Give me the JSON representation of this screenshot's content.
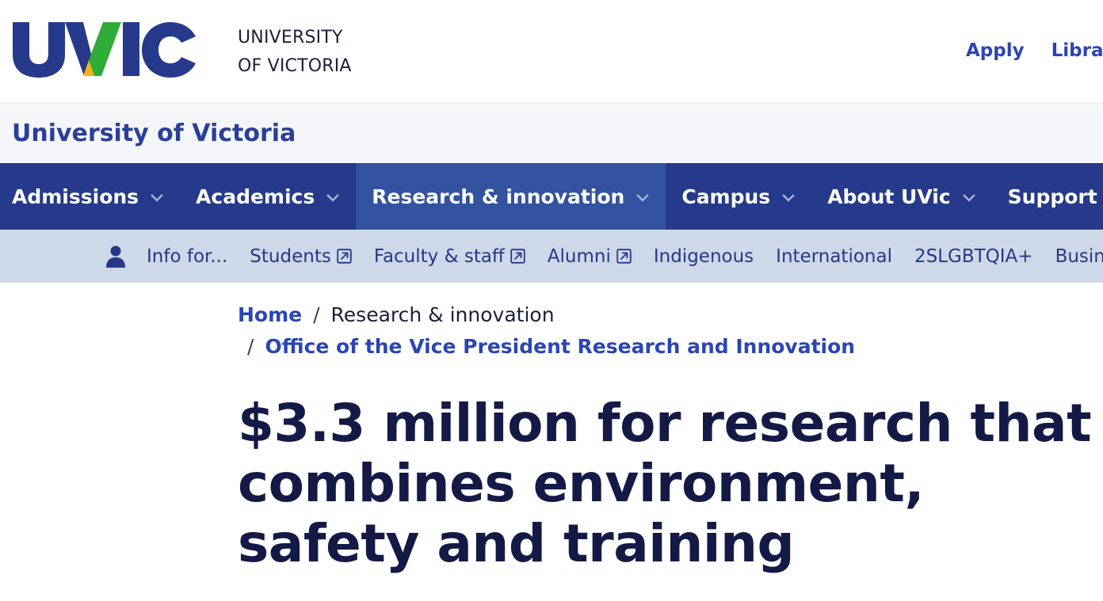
{
  "header": {
    "logo_alt": "UVIC",
    "wordmark_line1": "UNIVERSITY",
    "wordmark_line2": "OF VICTORIA",
    "utility_links": [
      "Apply",
      "Library"
    ]
  },
  "site_title": "University of Victoria",
  "main_nav": [
    {
      "label": "Admissions",
      "active": false
    },
    {
      "label": "Academics",
      "active": false
    },
    {
      "label": "Research & innovation",
      "active": true
    },
    {
      "label": "Campus",
      "active": false
    },
    {
      "label": "About UVic",
      "active": false
    },
    {
      "label": "Support UVic",
      "active": false
    }
  ],
  "audience": {
    "lead": "Info for...",
    "links": [
      {
        "label": "Students",
        "external": true
      },
      {
        "label": "Faculty & staff",
        "external": true
      },
      {
        "label": "Alumni",
        "external": true
      },
      {
        "label": "Indigenous",
        "external": false
      },
      {
        "label": "International",
        "external": false
      },
      {
        "label": "2SLGBTQIA+",
        "external": false
      },
      {
        "label": "Business",
        "external": false
      }
    ]
  },
  "breadcrumb": {
    "home": "Home",
    "separator": "/",
    "current": "Research & innovation",
    "office": "Office of the Vice President Research and Innovation"
  },
  "headline": "$3.3 million for research that combines environment, safety and training",
  "colors": {
    "brand_blue": "#26398a",
    "link_blue": "#2a45b4",
    "logo_green": "#2fab38",
    "logo_yellow": "#f3b317",
    "audience_bg": "#cdd8e8",
    "headline": "#141a46"
  }
}
